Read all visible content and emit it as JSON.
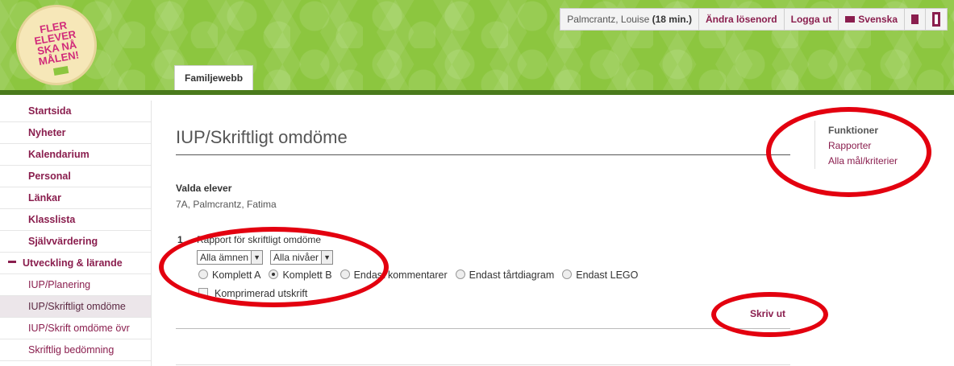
{
  "header": {
    "logo_text": "FLER ELEVER SKA NÅ MÅLEN!",
    "user_name": "Palmcrantz, Louise",
    "session_time": "(18 min.)",
    "change_password": "Ändra lösenord",
    "logout": "Logga ut",
    "language": "Svenska",
    "tab": "Familjewebb"
  },
  "sidebar": {
    "items": [
      {
        "label": "Startsida"
      },
      {
        "label": "Nyheter"
      },
      {
        "label": "Kalendarium"
      },
      {
        "label": "Personal"
      },
      {
        "label": "Länkar"
      },
      {
        "label": "Klasslista"
      },
      {
        "label": "Självvärdering"
      },
      {
        "label": "Utveckling & lärande"
      },
      {
        "label": "IUP/Planering"
      },
      {
        "label": "IUP/Skriftligt omdöme"
      },
      {
        "label": "IUP/Skrift omdöme övr"
      },
      {
        "label": "Skriftlig bedömning"
      }
    ]
  },
  "main": {
    "title": "IUP/Skriftligt omdöme",
    "selected_label": "Valda elever",
    "student": "7A, Palmcrantz, Fatima",
    "report_number": "1",
    "report_label": "Rapport för skriftligt omdöme",
    "subject_select": "Alla ämnen",
    "level_select": "Alla nivåer",
    "radio_options": [
      "Komplett A",
      "Komplett B",
      "Endast kommentarer",
      "Endast tårtdiagram",
      "Endast LEGO"
    ],
    "selected_radio": "Komplett B",
    "checkbox_label": "Komprimerad utskrift",
    "print": "Skriv ut"
  },
  "functions": {
    "heading": "Funktioner",
    "links": [
      "Rapporter",
      "Alla mål/kriterier"
    ]
  },
  "colors": {
    "accent": "#8a1e4e",
    "header_green": "#8cc63f",
    "annotation_red": "#e3000f"
  }
}
